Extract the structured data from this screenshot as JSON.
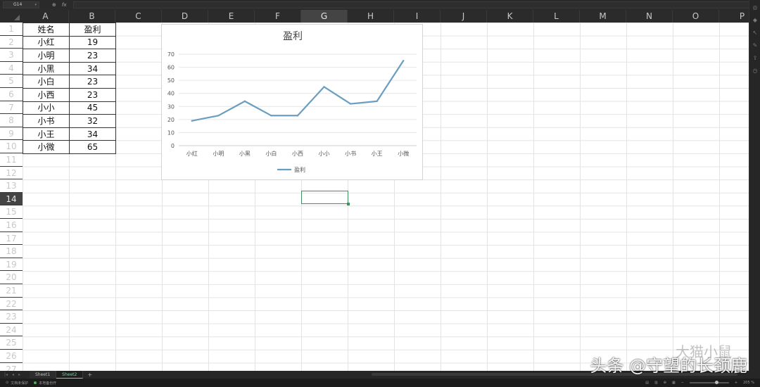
{
  "formula_bar": {
    "name_box": "G14",
    "fx_label": "fx"
  },
  "columns": [
    "A",
    "B",
    "C",
    "D",
    "E",
    "F",
    "G",
    "H",
    "I",
    "J",
    "K",
    "L",
    "M",
    "N",
    "O",
    "P"
  ],
  "selected_column": "G",
  "rows": [
    "1",
    "2",
    "3",
    "4",
    "5",
    "6",
    "7",
    "8",
    "9",
    "10",
    "11",
    "12",
    "13",
    "14",
    "15",
    "16",
    "17",
    "18",
    "19",
    "20",
    "21",
    "22",
    "23",
    "24",
    "25",
    "26",
    "27"
  ],
  "selected_row": "14",
  "table": {
    "header": [
      "姓名",
      "盈利"
    ],
    "rows": [
      [
        "小红",
        "19"
      ],
      [
        "小明",
        "23"
      ],
      [
        "小黑",
        "34"
      ],
      [
        "小白",
        "23"
      ],
      [
        "小西",
        "23"
      ],
      [
        "小小",
        "45"
      ],
      [
        "小书",
        "32"
      ],
      [
        "小王",
        "34"
      ],
      [
        "小微",
        "65"
      ]
    ]
  },
  "chart_data": {
    "type": "line",
    "title": "盈利",
    "categories": [
      "小红",
      "小明",
      "小黑",
      "小白",
      "小西",
      "小小",
      "小书",
      "小王",
      "小微"
    ],
    "series": [
      {
        "name": "盈利",
        "values": [
          19,
          23,
          34,
          23,
          23,
          45,
          32,
          34,
          65
        ],
        "color": "#6a9ec0"
      }
    ],
    "yticks": [
      "0",
      "10",
      "20",
      "30",
      "40",
      "50",
      "60",
      "70"
    ],
    "ylim": [
      0,
      70
    ],
    "grid": true,
    "legend_position": "bottom"
  },
  "sheets": [
    {
      "label": "Sheet1",
      "active": false
    },
    {
      "label": "Sheet2",
      "active": true
    }
  ],
  "add_sheet": "+",
  "status": {
    "left1": "文档未保护",
    "left2": "本地备份开",
    "zoom": "205 %"
  },
  "watermark": "头条 @守望的长颈鹿",
  "watermark_faint": "大猫小鼠"
}
